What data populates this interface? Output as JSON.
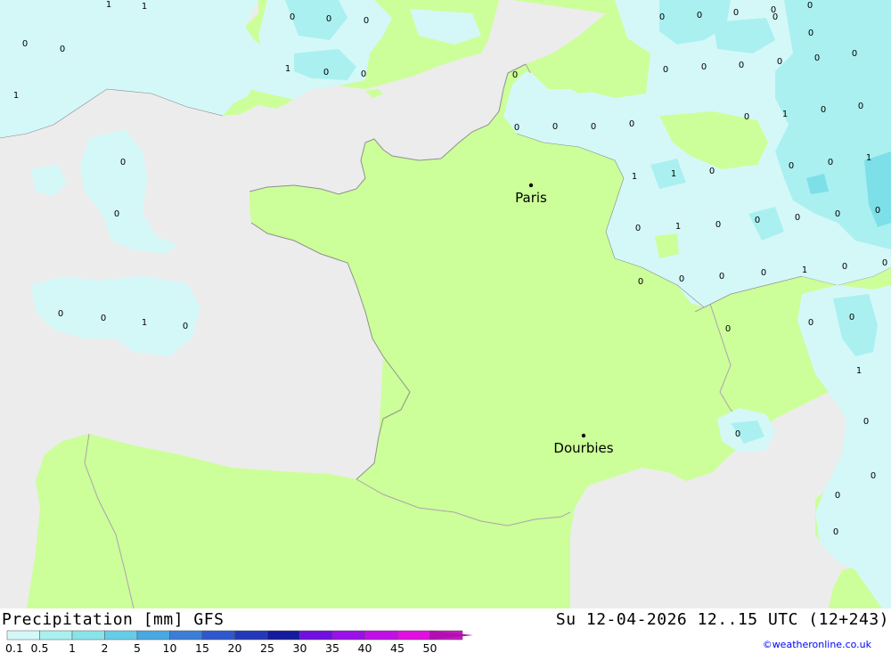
{
  "map": {
    "cities": [
      {
        "name": "Paris",
        "id": "paris"
      },
      {
        "name": "Dourbies",
        "id": "dourbies"
      }
    ],
    "contour_values": [
      "1",
      "1",
      "0",
      "0",
      "1",
      "0",
      "0",
      "0",
      "1",
      "0",
      "0",
      "0",
      "0",
      "0",
      "0",
      "1",
      "0",
      "0",
      "0",
      "0",
      "0",
      "0",
      "0",
      "0",
      "0",
      "0",
      "0",
      "0",
      "0",
      "0",
      "0",
      "0",
      "0",
      "0",
      "1",
      "0",
      "0",
      "1",
      "1",
      "0",
      "0",
      "0",
      "1",
      "0",
      "1",
      "0",
      "0",
      "0",
      "0",
      "0",
      "0",
      "0",
      "0",
      "0",
      "1",
      "0",
      "0",
      "0",
      "0",
      "0",
      "1",
      "0",
      "0",
      "0",
      "0",
      "0",
      "0",
      "0"
    ],
    "colors": {
      "sea": "#ececec",
      "land": "#ccff99",
      "precip_light": "#d4f8f8",
      "precip_mid": "#aaf0f0",
      "precip_heavy": "#7de0e8"
    }
  },
  "footer": {
    "title": "Precipitation [mm] GFS",
    "datetime": "Su 12-04-2026 12..15 UTC (12+243)",
    "credit": "©weatheronline.co.uk"
  },
  "legend": {
    "labels": [
      "0.1",
      "0.5",
      "1",
      "2",
      "5",
      "10",
      "15",
      "20",
      "25",
      "30",
      "35",
      "40",
      "45",
      "50"
    ],
    "colors": [
      "#d4f8f8",
      "#aaf0f0",
      "#88e4e8",
      "#66cce8",
      "#4aa8e0",
      "#3a7ed8",
      "#2e58cc",
      "#2238b8",
      "#141c9c",
      "#7010e0",
      "#9a10e8",
      "#c010e8",
      "#e010e0",
      "#c818c0",
      "#b010b0"
    ]
  }
}
